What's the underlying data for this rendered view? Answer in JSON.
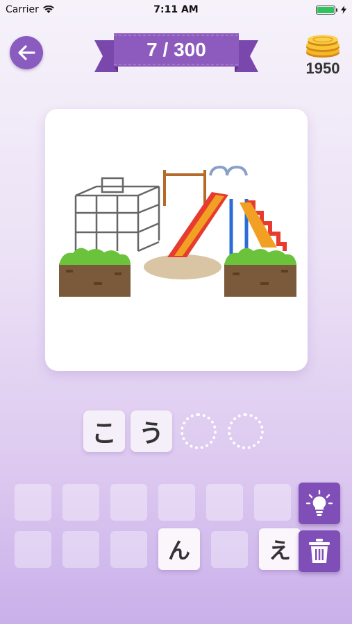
{
  "status": {
    "carrier": "Carrier",
    "time": "7:11 AM"
  },
  "header": {
    "progress": "7 / 300",
    "coins": "1950"
  },
  "answer": {
    "slots": [
      "こ",
      "う",
      "",
      ""
    ]
  },
  "keyboard": {
    "row1": [
      "",
      "",
      "",
      "",
      "",
      ""
    ],
    "row2": [
      "",
      "",
      "",
      "ん",
      "",
      "え"
    ]
  },
  "colors": {
    "accent": "#8a5cbf",
    "ribbon": "#8d5bbd",
    "tool": "#7f4fb7"
  },
  "icons": [
    "back-arrow-icon",
    "coins-icon",
    "lightbulb-icon",
    "trash-icon",
    "wifi-icon",
    "battery-icon",
    "charging-icon"
  ]
}
